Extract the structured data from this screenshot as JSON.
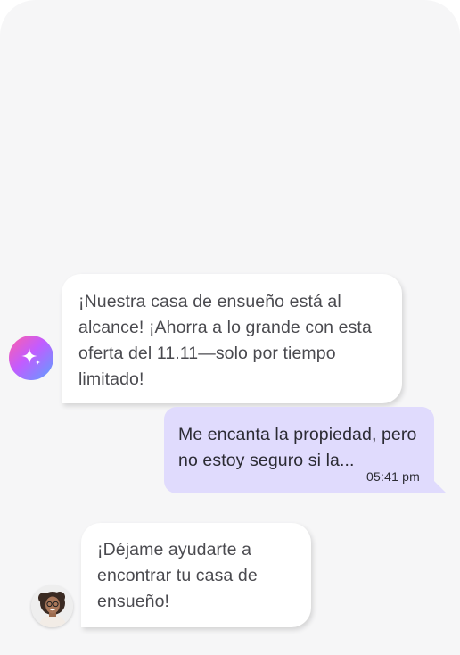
{
  "chat": {
    "messages": [
      {
        "sender": "assistant-ai",
        "text": "¡Nuestra casa de ensueño está al alcance! ¡Ahorra a lo grande con esta oferta del 11.11—solo por tiempo limitado!",
        "avatar_icon": "sparkle-icon"
      },
      {
        "sender": "user",
        "text": "Me encanta la propiedad, pero no estoy seguro si la...",
        "timestamp": "05:41 pm"
      },
      {
        "sender": "agent",
        "text": "¡Déjame ayudarte a encontrar tu casa de ensueño!",
        "avatar_icon": "person-photo"
      }
    ]
  },
  "colors": {
    "screen_background": "#f6f6f7",
    "incoming_bubble": "#ffffff",
    "outgoing_bubble": "#e0dbfd",
    "ai_avatar_gradient": [
      "#ff5fa8",
      "#c25cff",
      "#5aa2ff"
    ]
  }
}
